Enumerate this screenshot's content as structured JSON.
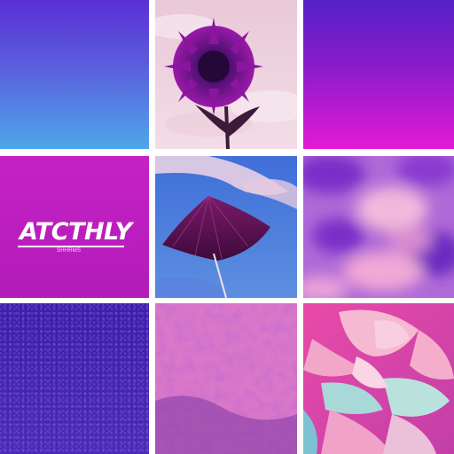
{
  "collage": {
    "tiles": [
      {
        "name": "blue-gradient-tile"
      },
      {
        "name": "purple-sunflower-tile"
      },
      {
        "name": "purple-magenta-gradient-tile"
      },
      {
        "name": "magenta-text-tile",
        "heading": "ATCTHLY",
        "subtext": "SHHRMS"
      },
      {
        "name": "umbrella-sky-tile"
      },
      {
        "name": "purple-clouds-tile"
      },
      {
        "name": "purple-noise-tile"
      },
      {
        "name": "pink-texture-tile"
      },
      {
        "name": "pink-rose-tile"
      }
    ]
  },
  "colors": {
    "blue_top": "#5b2fd6",
    "blue_bottom": "#4fa6ea",
    "magenta": "#c621c4",
    "deep_purple": "#3a1fa8",
    "pink": "#f5a3d8"
  }
}
